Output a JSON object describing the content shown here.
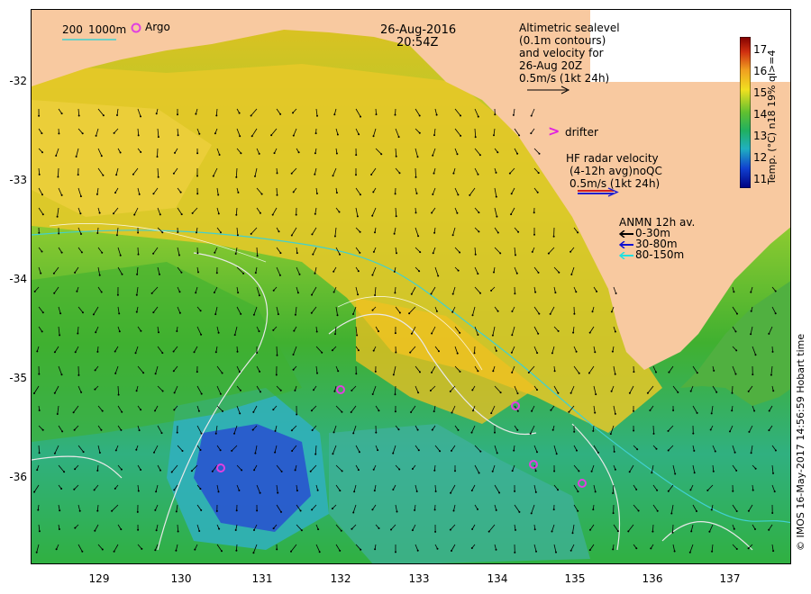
{
  "header": {
    "date": "26-Aug-2016",
    "time": "20:54Z"
  },
  "legend_top_left": {
    "depth_200": "200",
    "depth_1000": "1000m",
    "argo": "Argo",
    "argo_color": "#e040e0",
    "contour_color": "#40d0d0"
  },
  "sealevel": {
    "line1": "Altimetric sealevel",
    "line2": "(0.1m contours)",
    "line3": "and velocity for",
    "line4": "26-Aug 20Z",
    "scale": "0.5m/s (1kt 24h)"
  },
  "drifter": {
    "label": "drifter",
    "symbol": ">",
    "color": "#e020e0"
  },
  "hf_radar": {
    "line1": "HF radar velocity",
    "line2": "(4-12h avg)noQC",
    "scale": "0.5m/s (1kt 24h)"
  },
  "anmn": {
    "title": "ANMN 12h av.",
    "items": [
      {
        "label": "0-30m",
        "color": "#000000"
      },
      {
        "label": "30-80m",
        "color": "#1010d0"
      },
      {
        "label": "80-150m",
        "color": "#20e0e0"
      }
    ]
  },
  "colorbar": {
    "label": "Temp. (°C) n18 19% ql>=4",
    "ticks": [
      "17",
      "16",
      "15",
      "14",
      "13",
      "12",
      "11"
    ],
    "min": 10.6,
    "max": 17.6
  },
  "axes": {
    "lat_ticks": [
      "-32",
      "-33",
      "-34",
      "-35",
      "-36"
    ],
    "lon_ticks": [
      "129",
      "130",
      "131",
      "132",
      "133",
      "134",
      "135",
      "136",
      "137"
    ]
  },
  "credit": "© IMOS 16-May-2017 14:56:59 Hobart time",
  "colors": {
    "land": "#f8c9a0",
    "sea_warm": "#f0c020",
    "sea_mid": "#50c030",
    "sea_cool": "#20b0b0",
    "sea_cold": "#2050d0"
  }
}
